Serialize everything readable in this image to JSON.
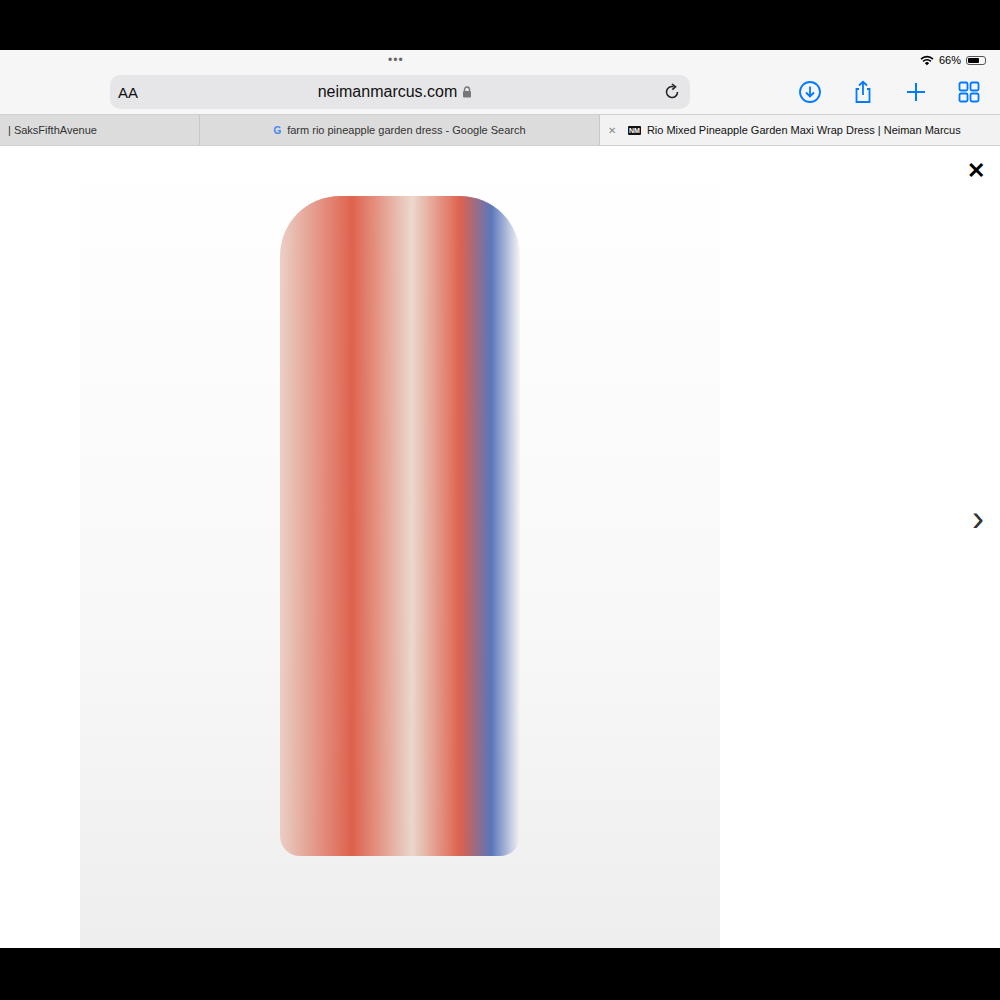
{
  "status_bar": {
    "dots": "•••",
    "battery": "66%",
    "battery_level": 0.66
  },
  "address_bar": {
    "reader_button": "AA",
    "url": "neimanmarcus.com",
    "secure": true
  },
  "tabs": [
    {
      "label": "| SaksFifthAvenue",
      "favicon": "",
      "selected": false,
      "closable": false
    },
    {
      "label": "farm rio pineapple garden dress - Google Search",
      "favicon": "G",
      "selected": false,
      "closable": false
    },
    {
      "label": "Rio Mixed Pineapple Garden Maxi Wrap Dress | Neiman Marcus",
      "favicon": "NM",
      "selected": true,
      "closable": true
    }
  ],
  "viewer": {
    "close": "✕",
    "next": "›",
    "tab_close": "✕"
  }
}
